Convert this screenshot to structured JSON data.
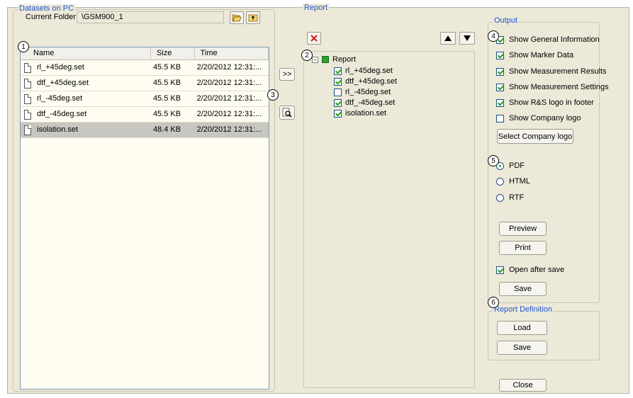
{
  "datasets": {
    "title": "Datasets on PC",
    "current_folder_label": "Current Folder",
    "current_folder_value": "\\GSM900_1",
    "columns": [
      "Name",
      "Size",
      "Time"
    ],
    "rows": [
      {
        "name": "rl_+45deg.set",
        "size": "45.5 KB",
        "time": "2/20/2012 12:31:..."
      },
      {
        "name": "dtf_+45deg.set",
        "size": "45.5 KB",
        "time": "2/20/2012 12:31:..."
      },
      {
        "name": "rl_-45deg.set",
        "size": "45.5 KB",
        "time": "2/20/2012 12:31:..."
      },
      {
        "name": "dtf_-45deg.set",
        "size": "45.5 KB",
        "time": "2/20/2012 12:31:..."
      },
      {
        "name": "isolation.set",
        "size": "48.4 KB",
        "time": "2/20/2012 12:31:..."
      }
    ]
  },
  "middle": {
    "add_label": ">>"
  },
  "report": {
    "title": "Report",
    "root_label": "Report",
    "items": [
      {
        "label": "rl_+45deg.set",
        "checked": true
      },
      {
        "label": "dtf_+45deg.set",
        "checked": true
      },
      {
        "label": "rl_-45deg.set",
        "checked": false
      },
      {
        "label": "dtf_-45deg.set",
        "checked": true
      },
      {
        "label": "isolation.set",
        "checked": true
      }
    ]
  },
  "output": {
    "title": "Output",
    "options": [
      {
        "label": "Show General Information",
        "checked": true
      },
      {
        "label": "Show Marker Data",
        "checked": true
      },
      {
        "label": "Show Measurement Results",
        "checked": true
      },
      {
        "label": "Show Measurement Settings",
        "checked": true
      },
      {
        "label": "Show R&S logo in footer",
        "checked": true
      },
      {
        "label": "Show Company logo",
        "checked": false
      }
    ],
    "select_logo_label": "Select Company logo",
    "formats": [
      {
        "label": "PDF",
        "selected": true
      },
      {
        "label": "HTML",
        "selected": false
      },
      {
        "label": "RTF",
        "selected": false
      }
    ],
    "preview_label": "Preview",
    "print_label": "Print",
    "open_after_save_label": "Open after save",
    "open_after_save_checked": true,
    "save_label": "Save"
  },
  "report_definition": {
    "title": "Report Definition",
    "load_label": "Load",
    "save_label": "Save"
  },
  "close_label": "Close",
  "callouts": [
    "1",
    "2",
    "3",
    "4",
    "5",
    "6"
  ],
  "colors": {
    "accent_text": "#2255cc",
    "check_green": "#21a121",
    "delete_red": "#d02020"
  }
}
